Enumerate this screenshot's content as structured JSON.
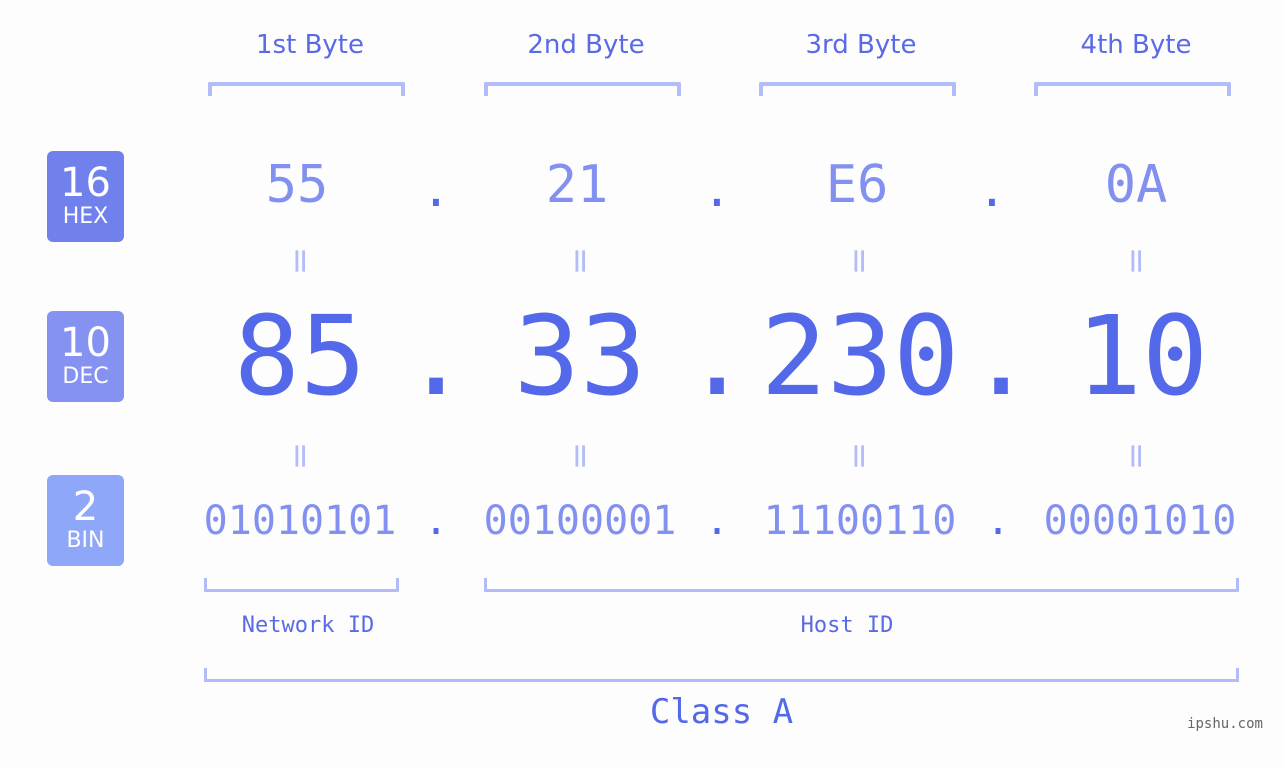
{
  "byte_headers": [
    "1st Byte",
    "2nd Byte",
    "3rd Byte",
    "4th Byte"
  ],
  "rows": {
    "hex": {
      "base": "16",
      "label": "HEX",
      "octets": [
        "55",
        "21",
        "E6",
        "0A"
      ],
      "color": "#7080ec"
    },
    "dec": {
      "base": "10",
      "label": "DEC",
      "octets": [
        "85",
        "33",
        "230",
        "10"
      ],
      "color": "#8592f1"
    },
    "bin": {
      "base": "2",
      "label": "BIN",
      "octets": [
        "01010101",
        "00100001",
        "11100110",
        "00001010"
      ],
      "color": "#8fa7f8"
    }
  },
  "separator": ".",
  "equals": "=",
  "network_id_label": "Network ID",
  "host_id_label": "Host ID",
  "class_label": "Class A",
  "watermark": "ipshu.com",
  "colors": {
    "primary": "#5468ea",
    "secondary": "#8290ef",
    "bracket": "#b2bcf9"
  }
}
